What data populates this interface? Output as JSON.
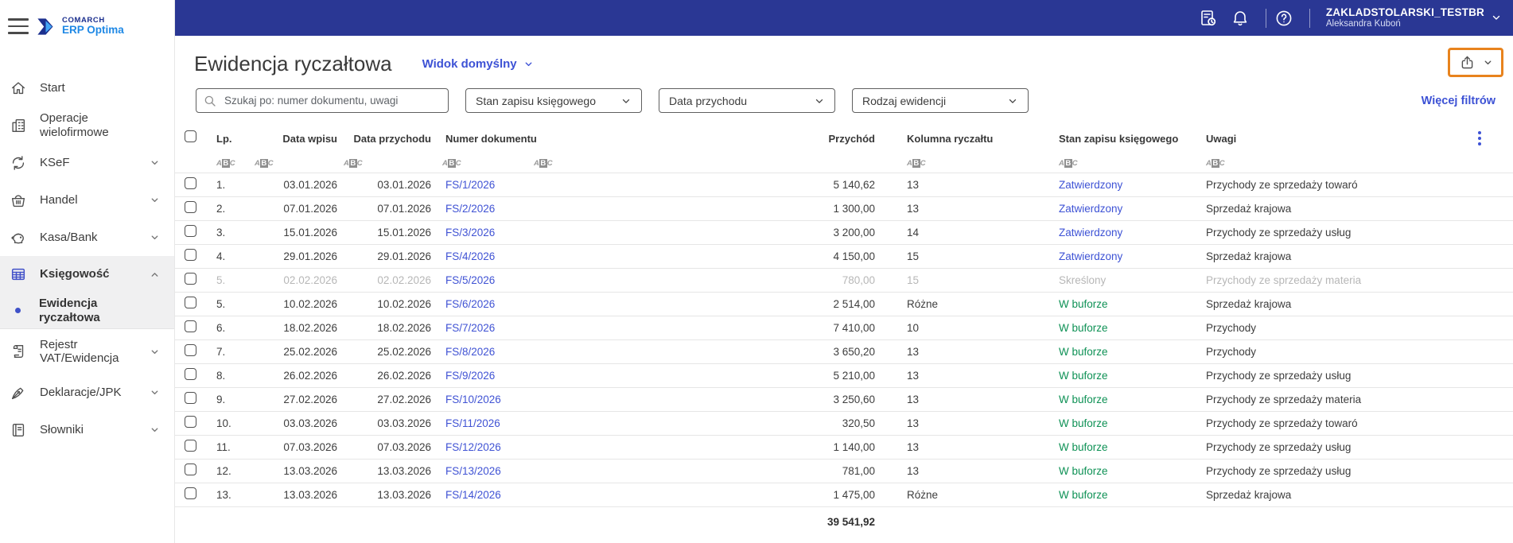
{
  "brand": {
    "name": "COMARCH",
    "product": "ERP Optima"
  },
  "topbar": {
    "company": "ZAKLADSTOLARSKI_TESTBR",
    "user": "Aleksandra Kuboń"
  },
  "sidebar": {
    "items": [
      {
        "label": "Start"
      },
      {
        "label": "Operacje wielofirmowe"
      },
      {
        "label": "KSeF"
      },
      {
        "label": "Handel"
      },
      {
        "label": "Kasa/Bank"
      },
      {
        "label": "Księgowość"
      },
      {
        "label": "Ewidencja ryczałtowa"
      },
      {
        "label": "Rejestr VAT/Ewidencja"
      },
      {
        "label": "Deklaracje/JPK"
      },
      {
        "label": "Słowniki"
      }
    ]
  },
  "page": {
    "title": "Ewidencja ryczałtowa",
    "view_selector": "Widok domyślny",
    "more_filters": "Więcej filtrów"
  },
  "filters": {
    "search_placeholder": "Szukaj po: numer dokumentu, uwagi",
    "dropdowns": [
      "Stan zapisu księgowego",
      "Data przychodu",
      "Rodzaj ewidencji"
    ]
  },
  "table": {
    "columns": [
      "Lp.",
      "Data wpisu",
      "Data przychodu",
      "Numer dokumentu",
      "Przychód",
      "Kolumna ryczałtu",
      "Stan zapisu księgowego",
      "Uwagi"
    ],
    "rows": [
      {
        "lp": "1.",
        "data_wpisu": "03.01.2026",
        "data_przychodu": "03.01.2026",
        "numer": "FS/1/2026",
        "przychod": "5 140,62",
        "kolumna": "13",
        "stan": "Zatwierdzony",
        "uwagi": "Przychody ze sprzedaży towaró",
        "struck": false
      },
      {
        "lp": "2.",
        "data_wpisu": "07.01.2026",
        "data_przychodu": "07.01.2026",
        "numer": "FS/2/2026",
        "przychod": "1 300,00",
        "kolumna": "13",
        "stan": "Zatwierdzony",
        "uwagi": "Sprzedaż krajowa",
        "struck": false
      },
      {
        "lp": "3.",
        "data_wpisu": "15.01.2026",
        "data_przychodu": "15.01.2026",
        "numer": "FS/3/2026",
        "przychod": "3 200,00",
        "kolumna": "14",
        "stan": "Zatwierdzony",
        "uwagi": "Przychody ze sprzedaży usług",
        "struck": false
      },
      {
        "lp": "4.",
        "data_wpisu": "29.01.2026",
        "data_przychodu": "29.01.2026",
        "numer": "FS/4/2026",
        "przychod": "4 150,00",
        "kolumna": "15",
        "stan": "Zatwierdzony",
        "uwagi": "Sprzedaż krajowa",
        "struck": false
      },
      {
        "lp": "5.",
        "data_wpisu": "02.02.2026",
        "data_przychodu": "02.02.2026",
        "numer": "FS/5/2026",
        "przychod": "780,00",
        "kolumna": "15",
        "stan": "Skreślony",
        "uwagi": "Przychody ze sprzedaży materia",
        "struck": true
      },
      {
        "lp": "5.",
        "data_wpisu": "10.02.2026",
        "data_przychodu": "10.02.2026",
        "numer": "FS/6/2026",
        "przychod": "2 514,00",
        "kolumna": "Różne",
        "stan": "W buforze",
        "uwagi": "Sprzedaż krajowa",
        "struck": false
      },
      {
        "lp": "6.",
        "data_wpisu": "18.02.2026",
        "data_przychodu": "18.02.2026",
        "numer": "FS/7/2026",
        "przychod": "7 410,00",
        "kolumna": "10",
        "stan": "W buforze",
        "uwagi": "Przychody",
        "struck": false
      },
      {
        "lp": "7.",
        "data_wpisu": "25.02.2026",
        "data_przychodu": "25.02.2026",
        "numer": "FS/8/2026",
        "przychod": "3 650,20",
        "kolumna": "13",
        "stan": "W buforze",
        "uwagi": "Przychody",
        "struck": false
      },
      {
        "lp": "8.",
        "data_wpisu": "26.02.2026",
        "data_przychodu": "26.02.2026",
        "numer": "FS/9/2026",
        "przychod": "5 210,00",
        "kolumna": "13",
        "stan": "W buforze",
        "uwagi": "Przychody ze sprzedaży usług",
        "struck": false
      },
      {
        "lp": "9.",
        "data_wpisu": "27.02.2026",
        "data_przychodu": "27.02.2026",
        "numer": "FS/10/2026",
        "przychod": "3 250,60",
        "kolumna": "13",
        "stan": "W buforze",
        "uwagi": "Przychody ze sprzedaży materia",
        "struck": false
      },
      {
        "lp": "10.",
        "data_wpisu": "03.03.2026",
        "data_przychodu": "03.03.2026",
        "numer": "FS/11/2026",
        "przychod": "320,50",
        "kolumna": "13",
        "stan": "W buforze",
        "uwagi": "Przychody ze sprzedaży towaró",
        "struck": false
      },
      {
        "lp": "11.",
        "data_wpisu": "07.03.2026",
        "data_przychodu": "07.03.2026",
        "numer": "FS/12/2026",
        "przychod": "1 140,00",
        "kolumna": "13",
        "stan": "W buforze",
        "uwagi": "Przychody ze sprzedaży usług",
        "struck": false
      },
      {
        "lp": "12.",
        "data_wpisu": "13.03.2026",
        "data_przychodu": "13.03.2026",
        "numer": "FS/13/2026",
        "przychod": "781,00",
        "kolumna": "13",
        "stan": "W buforze",
        "uwagi": "Przychody ze sprzedaży usług",
        "struck": false
      },
      {
        "lp": "13.",
        "data_wpisu": "13.03.2026",
        "data_przychodu": "13.03.2026",
        "numer": "FS/14/2026",
        "przychod": "1 475,00",
        "kolumna": "Różne",
        "stan": "W buforze",
        "uwagi": "Sprzedaż krajowa",
        "struck": false
      }
    ],
    "total": "39 541,92"
  },
  "colors": {
    "topbar": "#2a3794",
    "accent": "#3d52d5",
    "link": "#4053d4",
    "highlight_annotation": "#e8831d",
    "status": {
      "Zatwierdzony": "#3d52d5",
      "W buforze": "#0e9155",
      "Skreślony": "#b7b7b7"
    }
  }
}
